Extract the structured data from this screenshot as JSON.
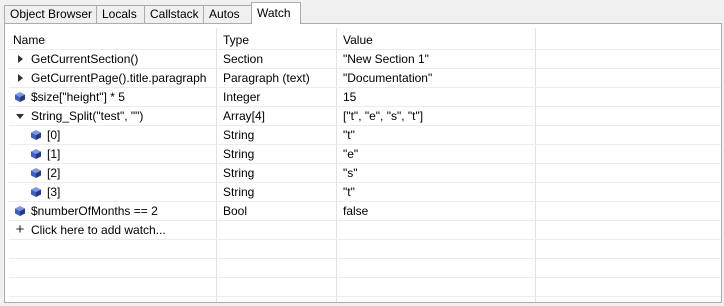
{
  "tabs": [
    {
      "label": "Object Browser"
    },
    {
      "label": "Locals"
    },
    {
      "label": "Callstack"
    },
    {
      "label": "Autos"
    },
    {
      "label": "Watch"
    }
  ],
  "active_tab": "Watch",
  "columns": {
    "name": "Name",
    "type": "Type",
    "value": "Value"
  },
  "rows": [
    {
      "name": "GetCurrentSection()",
      "type": "Section",
      "value": "\"New Section 1\"",
      "icon": "expand-right-icon"
    },
    {
      "name": "GetCurrentPage().title.paragraph",
      "type": "Paragraph (text)",
      "value": "\"Documentation\"",
      "icon": "expand-right-icon"
    },
    {
      "name": "$size[\"height\"] * 5",
      "type": "Integer",
      "value": "15",
      "icon": "variable-cube-icon"
    },
    {
      "name": "String_Split(\"test\", \"\")",
      "type": "Array[4]",
      "value": "[\"t\", \"e\", \"s\", \"t\"]",
      "icon": "expanded-down-icon"
    },
    {
      "name": "[0]",
      "type": "String",
      "value": "\"t\"",
      "icon": "variable-cube-icon"
    },
    {
      "name": "[1]",
      "type": "String",
      "value": "\"e\"",
      "icon": "variable-cube-icon"
    },
    {
      "name": "[2]",
      "type": "String",
      "value": "\"s\"",
      "icon": "variable-cube-icon"
    },
    {
      "name": "[3]",
      "type": "String",
      "value": "\"t\"",
      "icon": "variable-cube-icon"
    },
    {
      "name": "$numberOfMonths == 2",
      "type": "Bool",
      "value": "false",
      "icon": "variable-cube-icon"
    }
  ],
  "add_watch": {
    "label": "Click here to add watch...",
    "icon": "plus-icon"
  },
  "colors": {
    "cube": "#3b5fc7",
    "cube_dark": "#22398a"
  }
}
